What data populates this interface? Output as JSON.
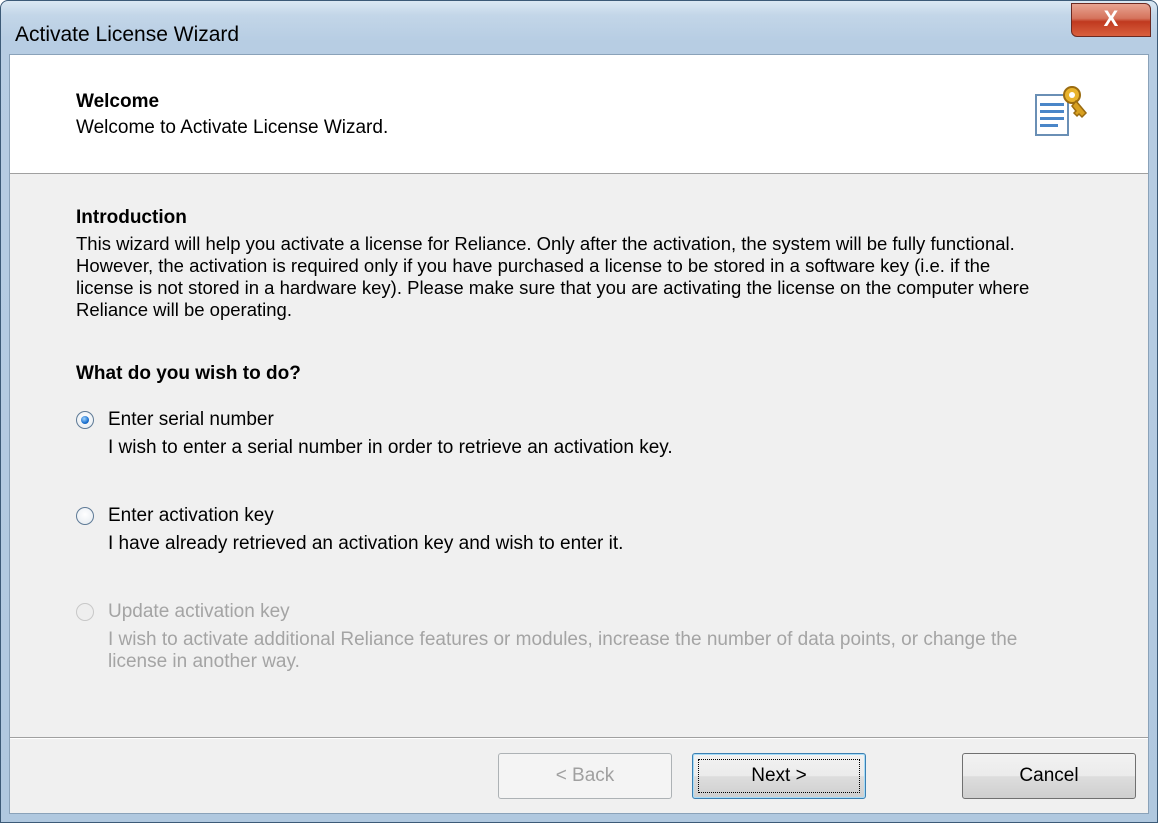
{
  "window": {
    "title": "Activate License Wizard",
    "close_glyph": "X"
  },
  "header": {
    "title": "Welcome",
    "subtitle": "Welcome to Activate License Wizard.",
    "icon": "license-key-document-icon"
  },
  "intro": {
    "title": "Introduction",
    "text": "This wizard will help you activate a license for Reliance. Only after the activation, the system will be fully functional. However, the activation is required only if you have purchased a license to be stored in a software key (i.e. if the license is not stored in a hardware key). Please make sure that you are activating the license on the computer where Reliance will be operating."
  },
  "question": "What do you wish to do?",
  "options": [
    {
      "label": "Enter serial number",
      "description": "I wish to enter a serial number in order to retrieve an activation key.",
      "checked": true,
      "enabled": true
    },
    {
      "label": "Enter activation key",
      "description": "I have already retrieved an activation key and wish to enter it.",
      "checked": false,
      "enabled": true
    },
    {
      "label": "Update activation key",
      "description": "I wish to activate additional Reliance features or modules, increase the number of data points, or change the license in another way.",
      "checked": false,
      "enabled": false
    }
  ],
  "buttons": {
    "back": "< Back",
    "next": "Next >",
    "cancel": "Cancel"
  },
  "colors": {
    "selected_radio": "#1a6fcf",
    "disabled_text": "#a4a4a4",
    "close_button": "#c0391f"
  }
}
